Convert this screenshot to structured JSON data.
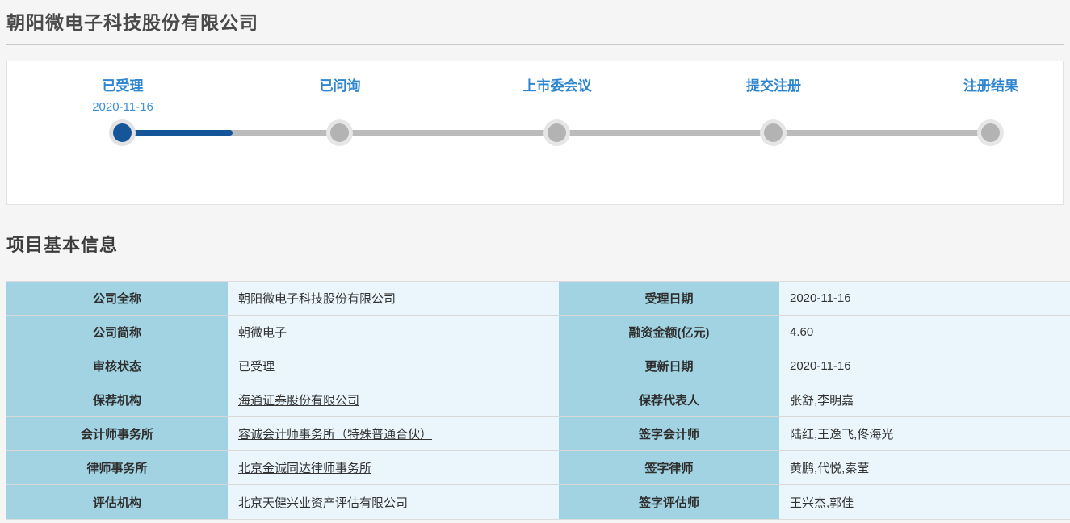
{
  "page": {
    "title": "朝阳微电子科技股份有限公司"
  },
  "stepper": {
    "steps": [
      {
        "label": "已受理",
        "date": "2020-11-16",
        "state": "done"
      },
      {
        "label": "已问询",
        "date": "",
        "state": "pending"
      },
      {
        "label": "上市委会议",
        "date": "",
        "state": "pending"
      },
      {
        "label": "提交注册",
        "date": "",
        "state": "pending"
      },
      {
        "label": "注册结果",
        "date": "",
        "state": "pending"
      }
    ]
  },
  "section": {
    "title": "项目基本信息"
  },
  "info_table": {
    "left_rows": [
      {
        "label": "公司全称",
        "value": "朝阳微电子科技股份有限公司",
        "link": false
      },
      {
        "label": "公司简称",
        "value": "朝微电子",
        "link": false
      },
      {
        "label": "审核状态",
        "value": "已受理",
        "link": false
      },
      {
        "label": "保荐机构",
        "value": "海通证券股份有限公司",
        "link": true
      },
      {
        "label": "会计师事务所",
        "value": "容诚会计师事务所（特殊普通合伙）",
        "link": true
      },
      {
        "label": "律师事务所",
        "value": "北京金诚同达律师事务所",
        "link": true
      },
      {
        "label": "评估机构",
        "value": "北京天健兴业资产评估有限公司",
        "link": true
      }
    ],
    "right_rows": [
      {
        "label": "受理日期",
        "value": "2020-11-16"
      },
      {
        "label": "融资金额(亿元)",
        "value": "4.60"
      },
      {
        "label": "更新日期",
        "value": "2020-11-16"
      },
      {
        "label": "保荐代表人",
        "value": "张舒,李明嘉"
      },
      {
        "label": "签字会计师",
        "value": "陆红,王逸飞,佟海光"
      },
      {
        "label": "签字律师",
        "value": "黄鹏,代悦,秦莹"
      },
      {
        "label": "签字评估师",
        "value": "王兴杰,郭佳"
      }
    ]
  },
  "colors": {
    "step_label_blue": "#2e86d0",
    "progress_blue": "#15559a",
    "inactive_gray": "#b3b3b3",
    "table_label_bg": "#a2d3e3",
    "table_value_bg": "#eaf6fb",
    "page_bg": "#f5f5f5"
  }
}
